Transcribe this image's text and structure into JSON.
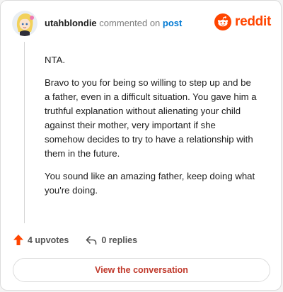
{
  "comment": {
    "username": "utahblondie",
    "action_text": "commented on",
    "post_link": "post",
    "paragraphs": [
      "NTA.",
      "Bravo to you for being so willing to step up and be a father, even in a difficult situation. You gave him a truthful explanation without alienating your child against their mother, very important if she somehow decides to try to have a relationship with them in the future.",
      "You sound like an amazing father, keep doing what you're doing."
    ],
    "upvotes": "4 upvotes",
    "replies": "0 replies",
    "view_label": "View the conversation"
  },
  "brand": {
    "name": "reddit",
    "color": "#ff4500"
  },
  "colors": {
    "link": "#0079d3",
    "upvote": "#ff4500",
    "view_button_text": "#c0392b"
  },
  "icons": {
    "avatar": "avatar",
    "brand": "reddit-logo-icon",
    "upvote": "upvote-arrow-icon",
    "reply": "reply-arrow-icon"
  }
}
